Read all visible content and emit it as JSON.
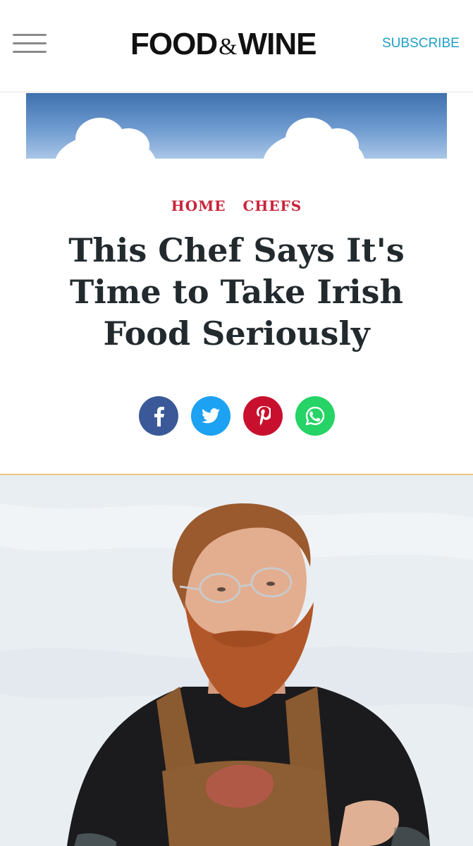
{
  "header": {
    "logo_left": "FOOD",
    "logo_amp": "&",
    "logo_right": "WINE",
    "subscribe_label": "SUBSCRIBE",
    "menu_icon": "hamburger-menu-icon",
    "accent_color": "#1fa0c7"
  },
  "breadcrumb": {
    "items": [
      "HOME",
      "CHEFS"
    ],
    "color": "#c8243a"
  },
  "article": {
    "title": "This Chef Says It's Time to Take Irish Food Seriously"
  },
  "share": {
    "buttons": [
      {
        "icon": "facebook-icon",
        "color": "#3b5998"
      },
      {
        "icon": "twitter-icon",
        "color": "#1da1f2"
      },
      {
        "icon": "pinterest-icon",
        "color": "#c8102e"
      },
      {
        "icon": "whatsapp-icon",
        "color": "#25d366"
      }
    ]
  }
}
